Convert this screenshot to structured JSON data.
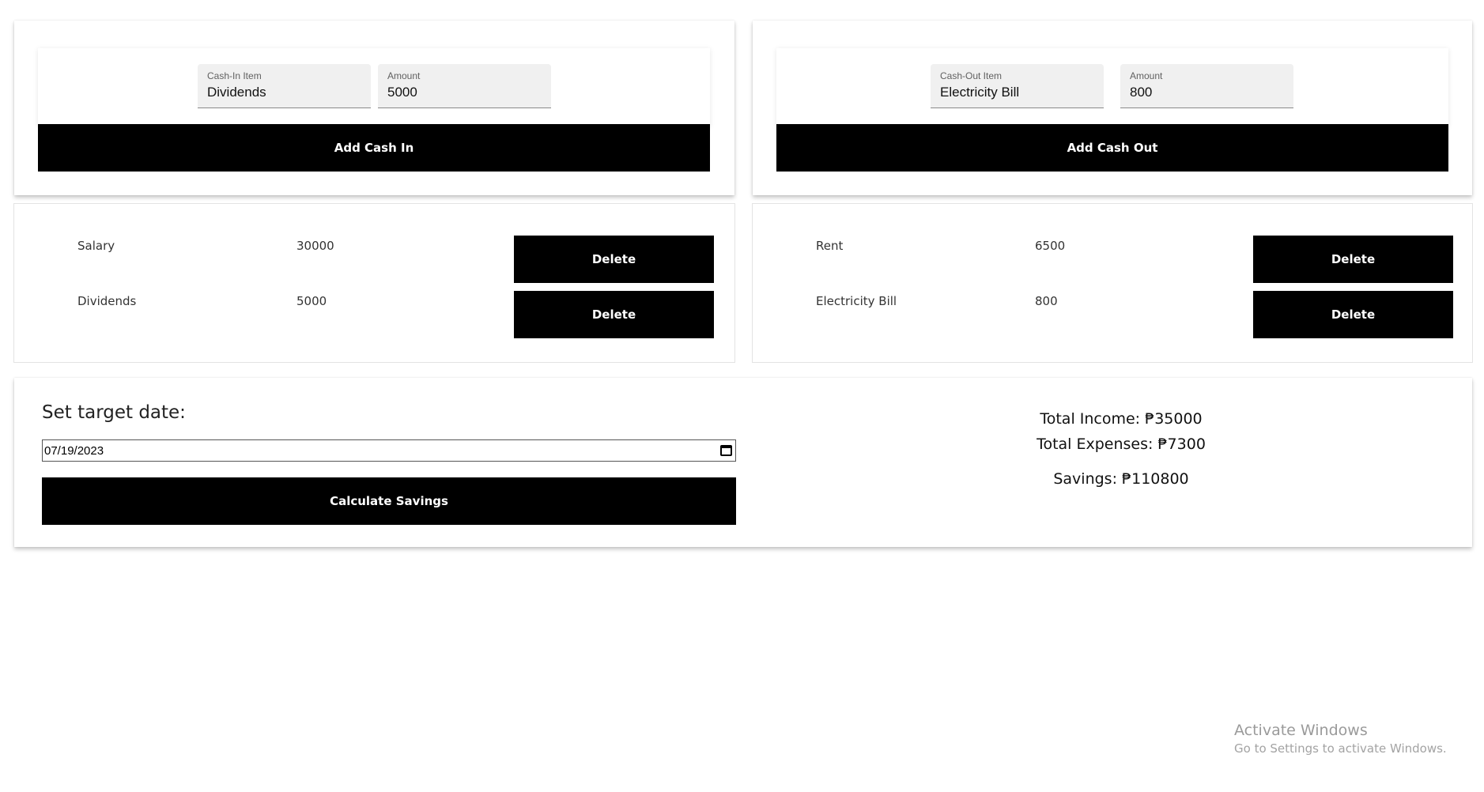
{
  "cash_in_form": {
    "item_label": "Cash-In Item",
    "item_value": "Dividends",
    "amount_label": "Amount",
    "amount_value": "5000",
    "submit_label": "Add Cash In"
  },
  "cash_out_form": {
    "item_label": "Cash-Out Item",
    "item_value": "Electricity Bill",
    "amount_label": "Amount",
    "amount_value": "800",
    "submit_label": "Add Cash Out"
  },
  "cash_in_list": [
    {
      "name": "Salary",
      "amount": "30000",
      "action": "Delete"
    },
    {
      "name": "Dividends",
      "amount": "5000",
      "action": "Delete"
    }
  ],
  "cash_out_list": [
    {
      "name": "Rent",
      "amount": "6500",
      "action": "Delete"
    },
    {
      "name": "Electricity Bill",
      "amount": "800",
      "action": "Delete"
    }
  ],
  "savings": {
    "date_label": "Set target date:",
    "date_value": "07/19/2023",
    "calculate_label": "Calculate Savings",
    "total_income": "Total Income: ₱35000",
    "total_expenses": "Total Expenses: ₱7300",
    "savings_result": "Savings: ₱110800"
  },
  "watermark": {
    "title": "Activate Windows",
    "subtitle": "Go to Settings to activate Windows."
  },
  "colors": {
    "button_bg": "#000000",
    "button_text": "#ffffff",
    "field_bg": "#f0f0f0"
  }
}
